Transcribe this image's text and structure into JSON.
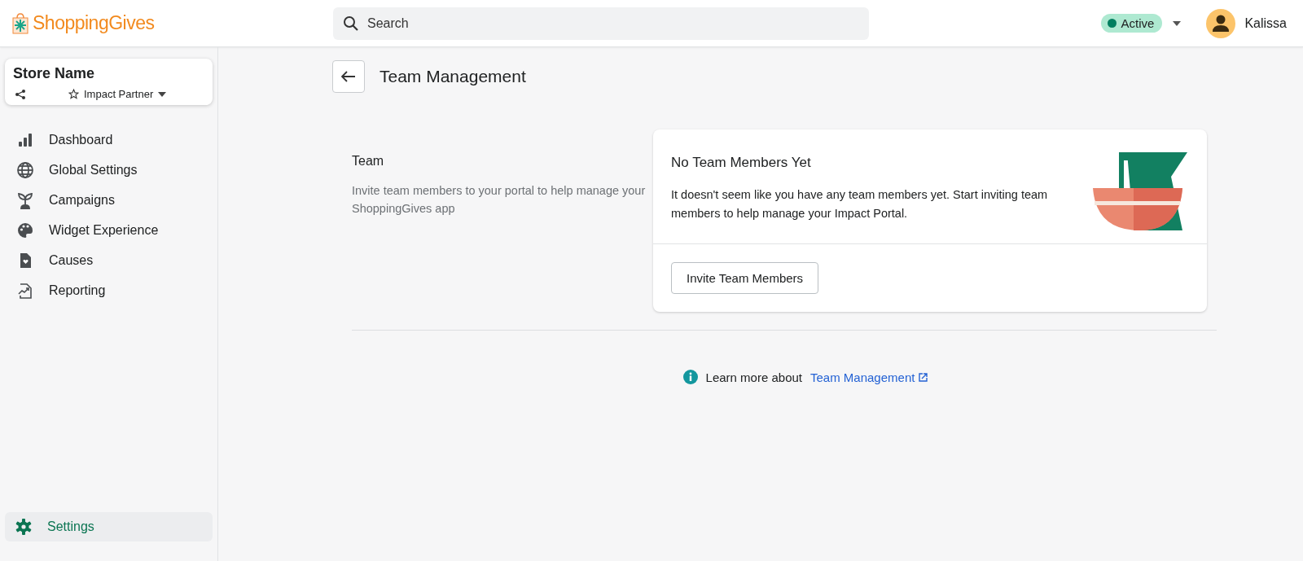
{
  "header": {
    "logo": "ShoppingGives",
    "search": {
      "placeholder": "Search"
    },
    "status": "Active",
    "user": "Kalissa"
  },
  "store": {
    "name": "Store Name",
    "tier": "Impact Partner"
  },
  "sidebar": {
    "items": [
      {
        "kind": "chart",
        "label": "Dashboard",
        "selected": false
      },
      {
        "kind": "globe",
        "label": "Global Settings",
        "selected": false
      },
      {
        "kind": "sprout",
        "label": "Campaigns",
        "selected": false
      },
      {
        "kind": "palette",
        "label": "Widget Experience",
        "selected": false
      },
      {
        "kind": "heart-doc",
        "label": "Causes",
        "selected": false
      },
      {
        "kind": "report",
        "label": "Reporting",
        "selected": false
      }
    ],
    "bottom_item": {
      "kind": "gear",
      "label": "Settings",
      "selected": true
    }
  },
  "page": {
    "title": "Team Management",
    "section": {
      "title": "Team",
      "description": "Invite team members to your portal to help manage your ShoppingGives app"
    },
    "card": {
      "title": "No Team Members Yet",
      "body": "It doesn't seem like you have any team members yet. Start inviting team members to help manage your Impact Portal.",
      "button": "Invite Team Members"
    },
    "footer": {
      "text": "Learn more about",
      "link": "Team Management"
    }
  }
}
